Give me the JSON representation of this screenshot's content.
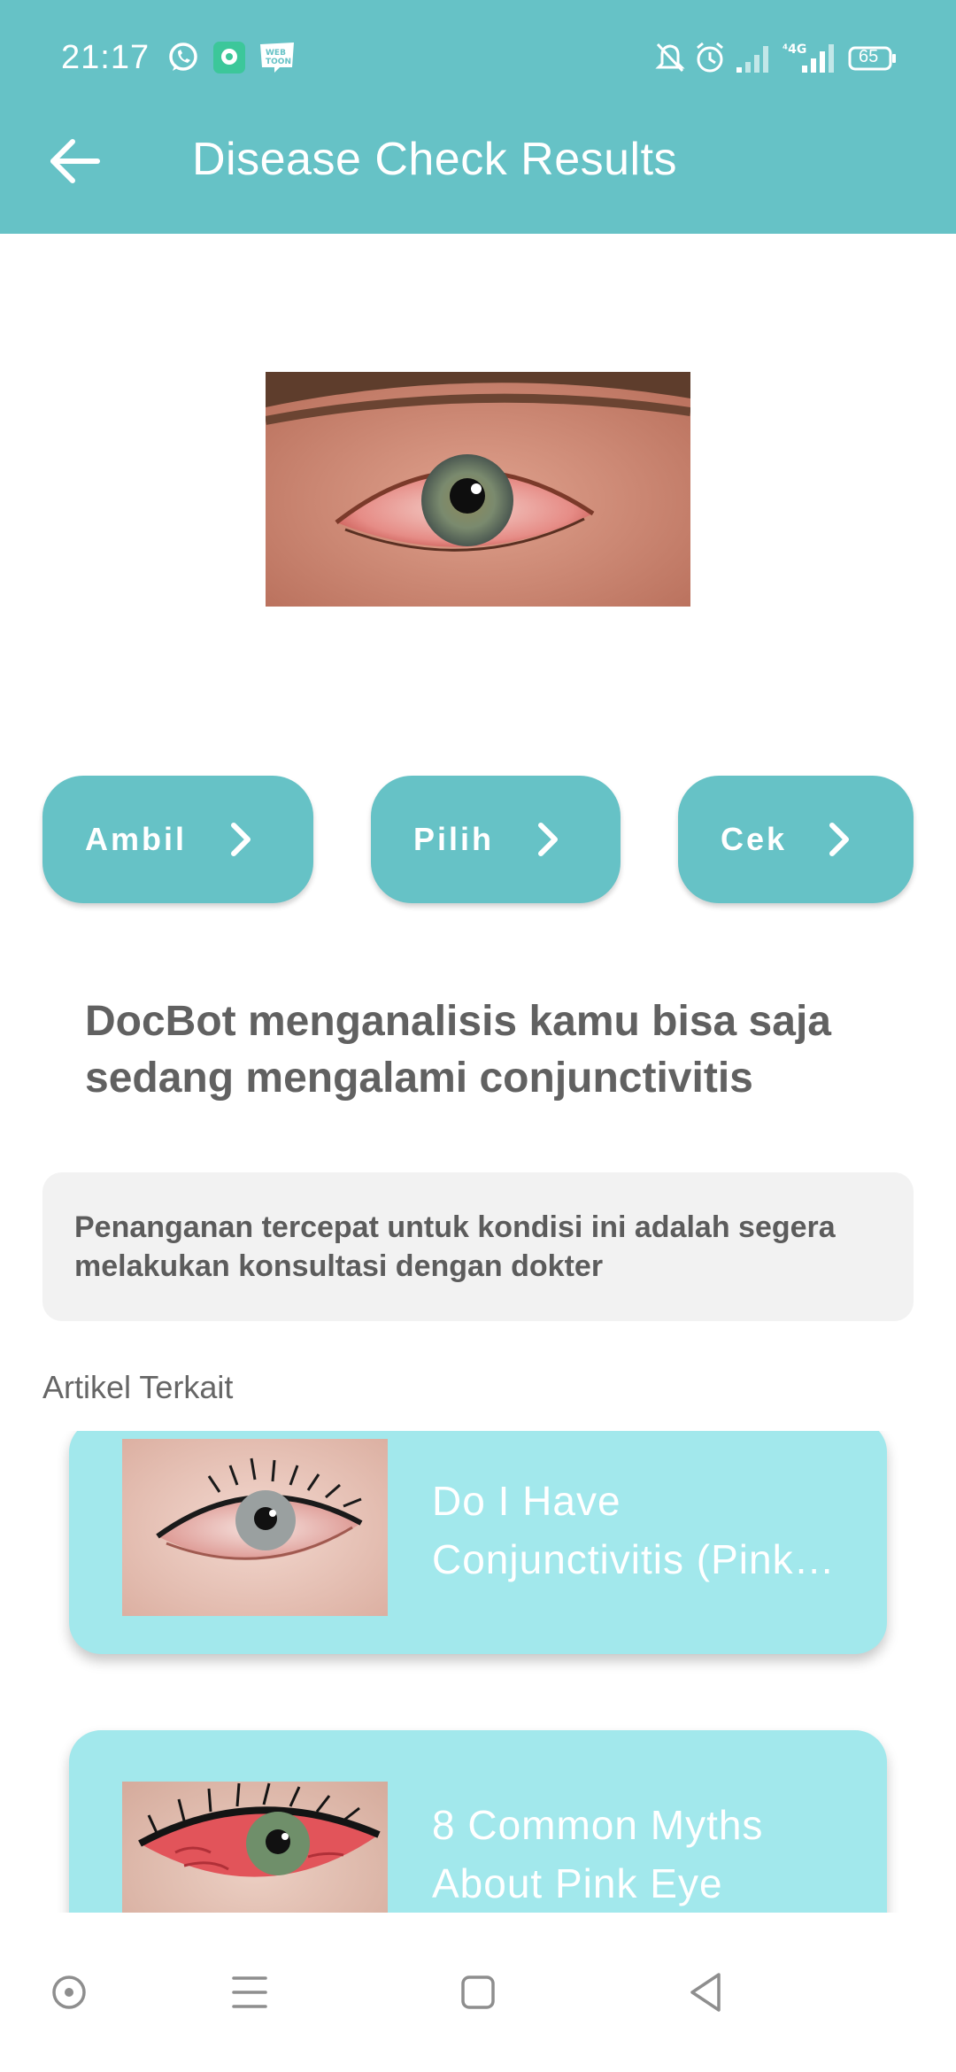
{
  "status_bar": {
    "time": "21:17",
    "battery": "65",
    "network": "4G",
    "icons": [
      "whatsapp-icon",
      "chat-app-icon",
      "webtoon-icon",
      "mute-bell-icon",
      "alarm-icon",
      "signal-icon",
      "battery-icon"
    ]
  },
  "header": {
    "title": "Disease Check Results",
    "back_icon": "arrow-left-icon"
  },
  "hero_image": {
    "description": "red-eye-photo"
  },
  "actions": [
    {
      "label": "Ambil",
      "icon": "chevron-right-icon"
    },
    {
      "label": "Pilih",
      "icon": "chevron-right-icon"
    },
    {
      "label": "Cek",
      "icon": "chevron-right-icon"
    }
  ],
  "analysis": {
    "text": "DocBot menganalisis kamu bisa saja sedang mengalami conjunctivitis"
  },
  "advice": {
    "text": "Penanganan tercepat untuk kondisi ini adalah segera melakukan konsultasi dengan dokter"
  },
  "related": {
    "label": "Artikel Terkait",
    "articles": [
      {
        "title": "Do I Have Conjunctivitis (Pink Eye)?"
      },
      {
        "title": "8 Common Myths About Pink Eye"
      }
    ]
  },
  "colors": {
    "primary": "#66c2c6",
    "card": "#a2e8ec",
    "advice_bg": "#f2f2f2"
  },
  "nav_bar": {
    "icons": [
      "assistant-icon",
      "menu-icon",
      "home-icon",
      "back-icon"
    ]
  }
}
